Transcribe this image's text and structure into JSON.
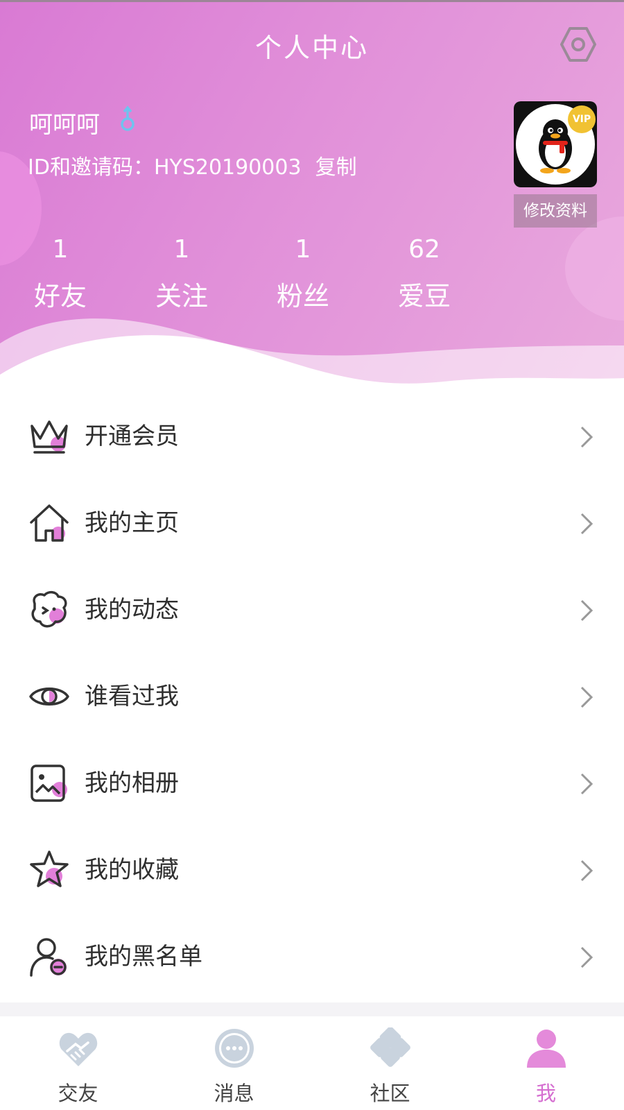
{
  "header": {
    "title": "个人中心",
    "settings_icon": "gear-icon"
  },
  "profile": {
    "username": "呵呵呵",
    "gender_icon": "male-icon",
    "id_label": "ID和邀请码：HYS20190003",
    "copy_label": "复制",
    "avatar_badge": "VIP",
    "edit_label": "修改资料"
  },
  "stats": [
    {
      "value": "1",
      "label": "好友"
    },
    {
      "value": "1",
      "label": "关注"
    },
    {
      "value": "1",
      "label": "粉丝"
    },
    {
      "value": "62",
      "label": "爱豆"
    }
  ],
  "menu": [
    {
      "label": "开通会员",
      "icon": "crown-icon"
    },
    {
      "label": "我的主页",
      "icon": "home-icon"
    },
    {
      "label": "我的动态",
      "icon": "dynamics-icon"
    },
    {
      "label": "谁看过我",
      "icon": "eye-icon"
    },
    {
      "label": "我的相册",
      "icon": "album-icon"
    },
    {
      "label": "我的收藏",
      "icon": "star-icon"
    },
    {
      "label": "我的黑名单",
      "icon": "blacklist-icon"
    }
  ],
  "tabs": [
    {
      "label": "交友",
      "icon": "handshake-icon",
      "active": false
    },
    {
      "label": "消息",
      "icon": "message-icon",
      "active": false
    },
    {
      "label": "社区",
      "icon": "community-icon",
      "active": false
    },
    {
      "label": "我",
      "icon": "person-icon",
      "active": true
    }
  ],
  "colors": {
    "accent": "#d56ed0",
    "header_start": "#d97ad4",
    "header_end": "#e9a9dd",
    "icon_pink": "#e27fd9",
    "tab_inactive_icon": "#c9d3de"
  }
}
